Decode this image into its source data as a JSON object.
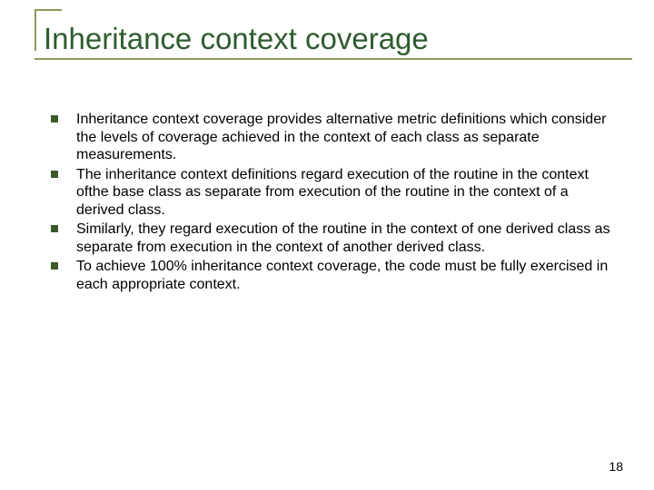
{
  "slide": {
    "title": "Inheritance context coverage",
    "bullets": [
      "Inheritance context coverage provides alternative metric definitions which consider the levels of coverage achieved in the context of each class as separate measurements.",
      "The inheritance context definitions regard execution of the routine in the context ofthe base class as separate from execution of the routine in the context of a derived class.",
      "Similarly, they regard execution of the routine in the context of one derived class as separate from execution in the context of another derived class.",
      "To achieve 100% inheritance context coverage, the code must be fully exercised in each appropriate context."
    ],
    "page_number": "18"
  }
}
